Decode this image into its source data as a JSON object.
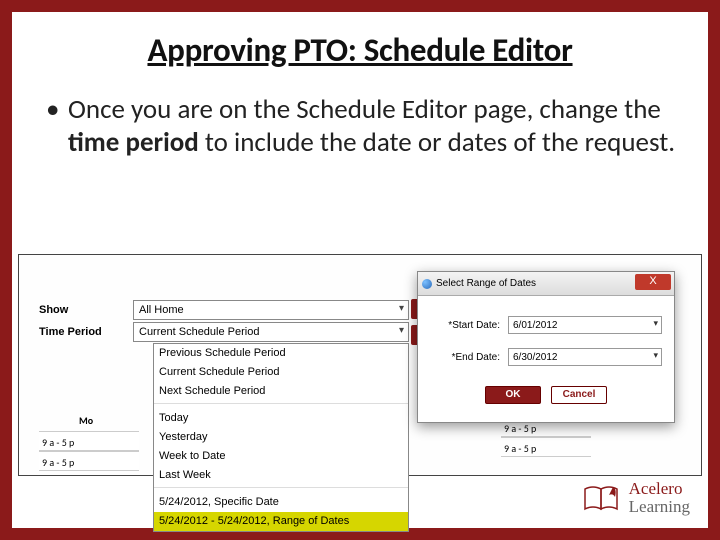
{
  "title": "Approving PTO: Schedule Editor",
  "bullet_pre": "Once you are on the Schedule Editor page, change the ",
  "bullet_bold": "time period",
  "bullet_post": " to include the date or dates of the request.",
  "form": {
    "show_label": "Show",
    "show_value": "All Home",
    "time_label": "Time Period",
    "time_value": "Current Schedule Period"
  },
  "dropdown": {
    "items": [
      "Previous Schedule Period",
      "Current Schedule Period",
      "Next Schedule Period",
      "Today",
      "Yesterday",
      "Week to Date",
      "Last Week",
      "5/24/2012, Specific Date",
      "5/24/2012 - 5/24/2012, Range of Dates"
    ]
  },
  "day_header": "Mo",
  "dialog": {
    "title": "Select Range of Dates",
    "close": "X",
    "start_label": "*Start Date:",
    "start_value": "6/01/2012",
    "end_label": "*End Date:",
    "end_value": "6/30/2012",
    "ok": "OK",
    "cancel": "Cancel"
  },
  "cells": {
    "a": "9 a - 5 p",
    "b": "9 a - 5 p",
    "c": "9 a - 5 p",
    "d": "9 a - 5 p"
  },
  "logo": {
    "top": "Acelero",
    "bot": "Learning"
  }
}
